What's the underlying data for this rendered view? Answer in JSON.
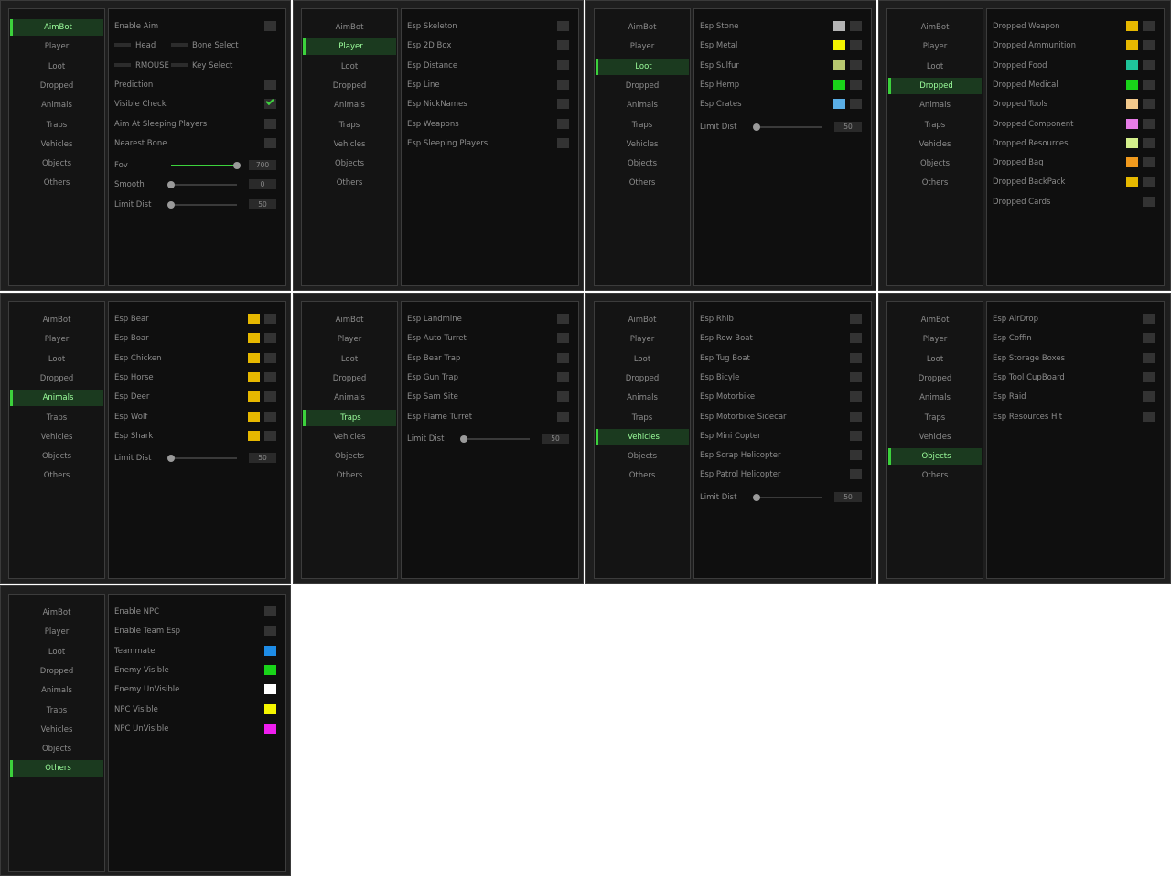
{
  "tabs": [
    "AimBot",
    "Player",
    "Loot",
    "Dropped",
    "Animals",
    "Traps",
    "Vehicles",
    "Objects",
    "Others"
  ],
  "colors": {
    "yellow": "#e6b800",
    "gray": "#b4b4b4",
    "bright_yellow": "#f5f500",
    "khaki": "#b8c870",
    "green": "#19d419",
    "light_blue": "#5aaee6",
    "teal": "#1fc49a",
    "peach": "#f2c98c",
    "violet": "#e67ce6",
    "lime": "#d4f08c",
    "orange": "#f09a1e",
    "blue": "#1e8ce6",
    "white": "#ffffff",
    "magenta": "#f01ef0"
  },
  "panels": [
    {
      "active": 0,
      "items": [
        {
          "type": "check",
          "label": "Enable Aim",
          "on": false
        },
        {
          "type": "keys",
          "keys": [
            {
              "label": "Head"
            },
            {
              "label": "Bone Select"
            }
          ]
        },
        {
          "type": "keys",
          "keys": [
            {
              "label": "RMOUSE"
            },
            {
              "label": "Key Select"
            }
          ]
        },
        {
          "type": "check",
          "label": "Prediction",
          "on": false
        },
        {
          "type": "check",
          "label": "Visible Check",
          "on": true
        },
        {
          "type": "check",
          "label": "Aim At Sleeping Players",
          "on": false
        },
        {
          "type": "check",
          "label": "Nearest Bone",
          "on": false
        },
        {
          "type": "slider",
          "label": "Fov",
          "value": "700",
          "fraction": 1.0
        },
        {
          "type": "slider",
          "label": "Smooth",
          "value": "0",
          "fraction": 0.0
        },
        {
          "type": "slider",
          "label": "Limit Dist",
          "value": "50",
          "fraction": 0.0
        }
      ]
    },
    {
      "active": 1,
      "items": [
        {
          "type": "check",
          "label": "Esp Skeleton"
        },
        {
          "type": "check",
          "label": "Esp 2D Box"
        },
        {
          "type": "check",
          "label": "Esp Distance"
        },
        {
          "type": "check",
          "label": "Esp Line"
        },
        {
          "type": "check",
          "label": "Esp NickNames"
        },
        {
          "type": "check",
          "label": "Esp Weapons"
        },
        {
          "type": "check",
          "label": "Esp Sleeping Players"
        }
      ]
    },
    {
      "active": 2,
      "items": [
        {
          "type": "color",
          "label": "Esp Stone",
          "color": "gray"
        },
        {
          "type": "color",
          "label": "Esp Metal",
          "color": "bright_yellow"
        },
        {
          "type": "color",
          "label": "Esp Sulfur",
          "color": "khaki"
        },
        {
          "type": "color",
          "label": "Esp Hemp",
          "color": "green"
        },
        {
          "type": "color",
          "label": "Esp Crates",
          "color": "light_blue"
        },
        {
          "type": "slider",
          "label": "Limit Dist",
          "value": "50",
          "fraction": 0.0
        }
      ]
    },
    {
      "active": 3,
      "items": [
        {
          "type": "color",
          "label": "Dropped Weapon",
          "color": "yellow"
        },
        {
          "type": "color",
          "label": "Dropped Ammunition",
          "color": "yellow"
        },
        {
          "type": "color",
          "label": "Dropped Food",
          "color": "teal"
        },
        {
          "type": "color",
          "label": "Dropped Medical",
          "color": "green"
        },
        {
          "type": "color",
          "label": "Dropped Tools",
          "color": "peach"
        },
        {
          "type": "color",
          "label": "Dropped Component",
          "color": "violet"
        },
        {
          "type": "color",
          "label": "Dropped Resources",
          "color": "lime"
        },
        {
          "type": "color",
          "label": "Dropped Bag",
          "color": "orange"
        },
        {
          "type": "color",
          "label": "Dropped BackPack",
          "color": "yellow"
        },
        {
          "type": "check",
          "label": "Dropped Cards"
        }
      ]
    },
    {
      "active": 4,
      "items": [
        {
          "type": "color",
          "label": "Esp Bear",
          "color": "yellow"
        },
        {
          "type": "color",
          "label": "Esp Boar",
          "color": "yellow"
        },
        {
          "type": "color",
          "label": "Esp Chicken",
          "color": "yellow"
        },
        {
          "type": "color",
          "label": "Esp Horse",
          "color": "yellow"
        },
        {
          "type": "color",
          "label": "Esp Deer",
          "color": "yellow"
        },
        {
          "type": "color",
          "label": "Esp Wolf",
          "color": "yellow"
        },
        {
          "type": "color",
          "label": "Esp Shark",
          "color": "yellow"
        },
        {
          "type": "slider",
          "label": "Limit Dist",
          "value": "50",
          "fraction": 0.0
        }
      ]
    },
    {
      "active": 5,
      "items": [
        {
          "type": "check",
          "label": "Esp Landmine"
        },
        {
          "type": "check",
          "label": "Esp Auto Turret"
        },
        {
          "type": "check",
          "label": "Esp Bear Trap"
        },
        {
          "type": "check",
          "label": "Esp Gun Trap"
        },
        {
          "type": "check",
          "label": "Esp Sam Site"
        },
        {
          "type": "check",
          "label": "Esp Flame Turret"
        },
        {
          "type": "slider",
          "label": "Limit Dist",
          "value": "50",
          "fraction": 0.0
        }
      ]
    },
    {
      "active": 6,
      "items": [
        {
          "type": "check",
          "label": "Esp Rhib"
        },
        {
          "type": "check",
          "label": "Esp Row Boat"
        },
        {
          "type": "check",
          "label": "Esp Tug Boat"
        },
        {
          "type": "check",
          "label": "Esp Bicyle"
        },
        {
          "type": "check",
          "label": "Esp Motorbike"
        },
        {
          "type": "check",
          "label": "Esp Motorbike Sidecar"
        },
        {
          "type": "check",
          "label": "Esp Mini Copter"
        },
        {
          "type": "check",
          "label": "Esp Scrap Helicopter"
        },
        {
          "type": "check",
          "label": "Esp Patrol Helicopter"
        },
        {
          "type": "slider",
          "label": "Limit Dist",
          "value": "50",
          "fraction": 0.0
        }
      ]
    },
    {
      "active": 7,
      "items": [
        {
          "type": "check",
          "label": "Esp AirDrop"
        },
        {
          "type": "check",
          "label": "Esp Coffin"
        },
        {
          "type": "check",
          "label": "Esp Storage Boxes"
        },
        {
          "type": "check",
          "label": "Esp Tool CupBoard"
        },
        {
          "type": "check",
          "label": "Esp Raid"
        },
        {
          "type": "check",
          "label": "Esp Resources Hit"
        }
      ]
    },
    {
      "active": 8,
      "items": [
        {
          "type": "check",
          "label": "Enable NPC"
        },
        {
          "type": "check",
          "label": "Enable Team Esp"
        },
        {
          "type": "colorsolo",
          "label": "Teammate",
          "color": "blue"
        },
        {
          "type": "colorsolo",
          "label": "Enemy Visible",
          "color": "green"
        },
        {
          "type": "colorsolo",
          "label": "Enemy UnVisible",
          "color": "white"
        },
        {
          "type": "colorsolo",
          "label": "NPC Visible",
          "color": "bright_yellow"
        },
        {
          "type": "colorsolo",
          "label": "NPC UnVisible",
          "color": "magenta"
        }
      ]
    }
  ]
}
